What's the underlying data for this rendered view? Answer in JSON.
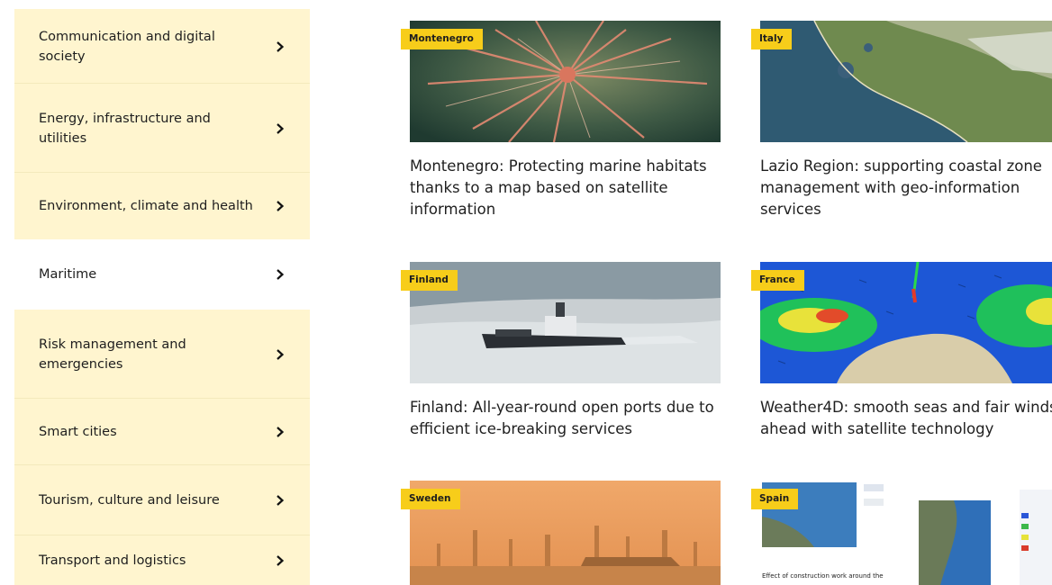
{
  "sidebar": {
    "items": [
      {
        "label": "Communication and digital society"
      },
      {
        "label": "Energy, infrastructure and utilities"
      },
      {
        "label": "Environment, climate and health"
      },
      {
        "label": "Maritime"
      },
      {
        "label": "Risk management and emergencies"
      },
      {
        "label": "Smart cities"
      },
      {
        "label": "Tourism, culture and leisure"
      },
      {
        "label": "Transport and logistics"
      }
    ],
    "chevron_icon": "chevron-right-icon",
    "highlight_color": "#fff5cf"
  },
  "cards": [
    {
      "tag": "Montenegro",
      "title": "Montenegro: Protecting marine habitats thanks to a map based on satellite information"
    },
    {
      "tag": "Italy",
      "title": "Lazio Region: supporting coastal zone management with geo-information services"
    },
    {
      "tag": "Finland",
      "title": "Finland: All-year-round open ports due to efficient ice-breaking services"
    },
    {
      "tag": "France",
      "title": "Weather4D: smooth seas and fair winds ahead with satellite technology"
    },
    {
      "tag": "Sweden",
      "title": ""
    },
    {
      "tag": "Spain",
      "title": ""
    }
  ],
  "spain_image_caption": "Effect of construction work around the",
  "tag_color": "#f7cd1a"
}
